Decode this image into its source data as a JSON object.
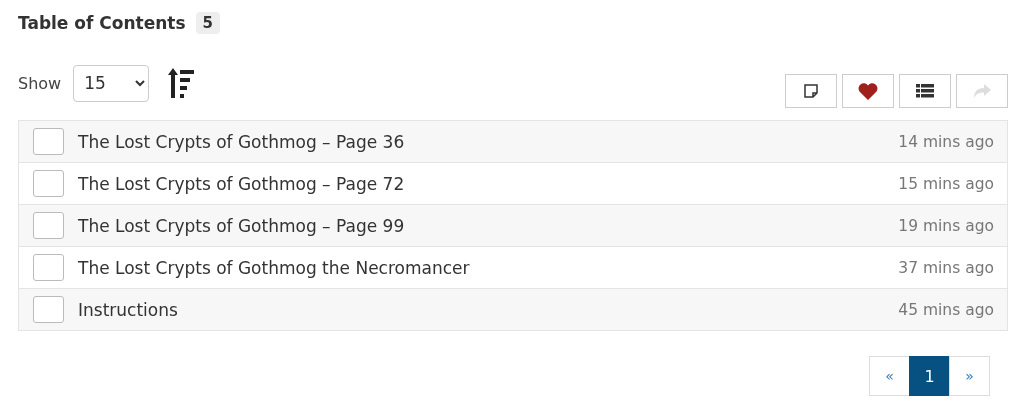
{
  "header": {
    "title": "Table of Contents",
    "count": "5"
  },
  "controls": {
    "show_label": "Show",
    "page_size": "15"
  },
  "toolbar": [
    {
      "kind": "note",
      "disabled": false
    },
    {
      "kind": "heart",
      "disabled": false
    },
    {
      "kind": "list",
      "disabled": false
    },
    {
      "kind": "share",
      "disabled": true
    }
  ],
  "rows": [
    {
      "title": "The Lost Crypts of Gothmog – Page 36",
      "time": "14 mins ago",
      "checked": false
    },
    {
      "title": "The Lost Crypts of Gothmog – Page 72",
      "time": "15 mins ago",
      "checked": false
    },
    {
      "title": "The Lost Crypts of Gothmog – Page 99",
      "time": "19 mins ago",
      "checked": false
    },
    {
      "title": "The Lost Crypts of Gothmog the Necromancer",
      "time": "37 mins ago",
      "checked": false
    },
    {
      "title": "Instructions",
      "time": "45 mins ago",
      "checked": false
    }
  ],
  "pagination": [
    {
      "label": "«",
      "selected": false
    },
    {
      "label": "1",
      "selected": true
    },
    {
      "label": "»",
      "selected": false
    }
  ]
}
